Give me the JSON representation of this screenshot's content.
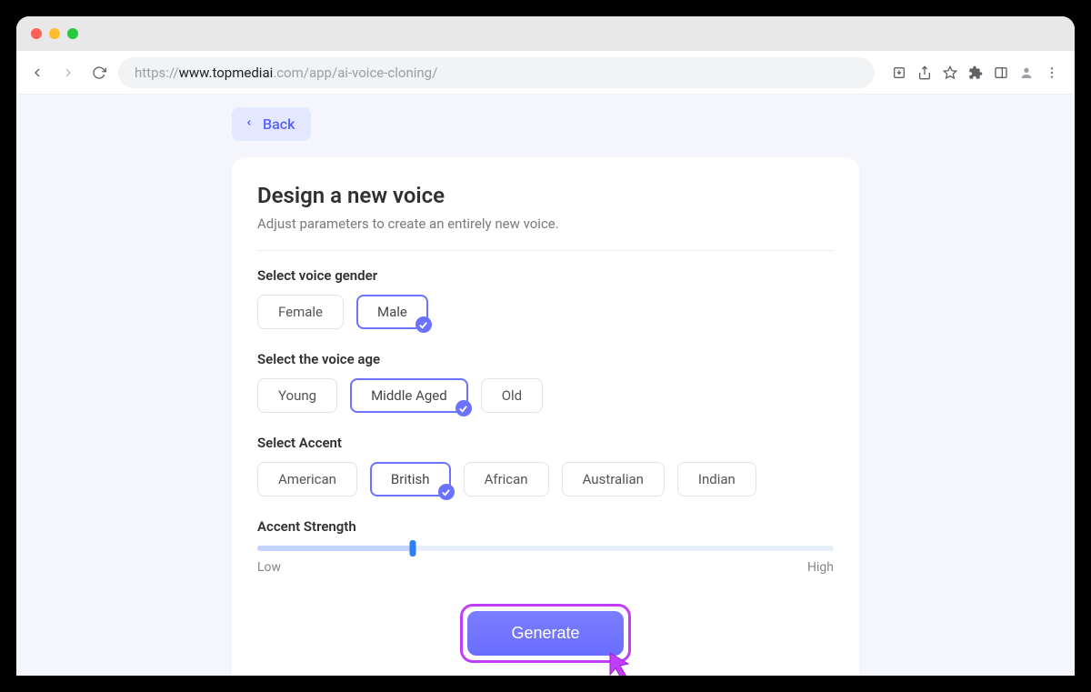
{
  "browser": {
    "url_prefix": "https://",
    "url_host": "www.topmediai",
    "url_rest": ".com/app/ai-voice-cloning/"
  },
  "back_button": {
    "label": "Back"
  },
  "page": {
    "title": "Design a new voice",
    "subtitle": "Adjust parameters to create an entirely new voice."
  },
  "gender": {
    "label": "Select voice gender",
    "options": [
      "Female",
      "Male"
    ],
    "selected": "Male"
  },
  "age": {
    "label": "Select the voice age",
    "options": [
      "Young",
      "Middle Aged",
      "Old"
    ],
    "selected": "Middle Aged"
  },
  "accent": {
    "label": "Select Accent",
    "options": [
      "American",
      "British",
      "African",
      "Australian",
      "Indian"
    ],
    "selected": "British"
  },
  "strength": {
    "label": "Accent Strength",
    "low": "Low",
    "high": "High",
    "value_pct": 27
  },
  "generate": {
    "label": "Generate"
  }
}
